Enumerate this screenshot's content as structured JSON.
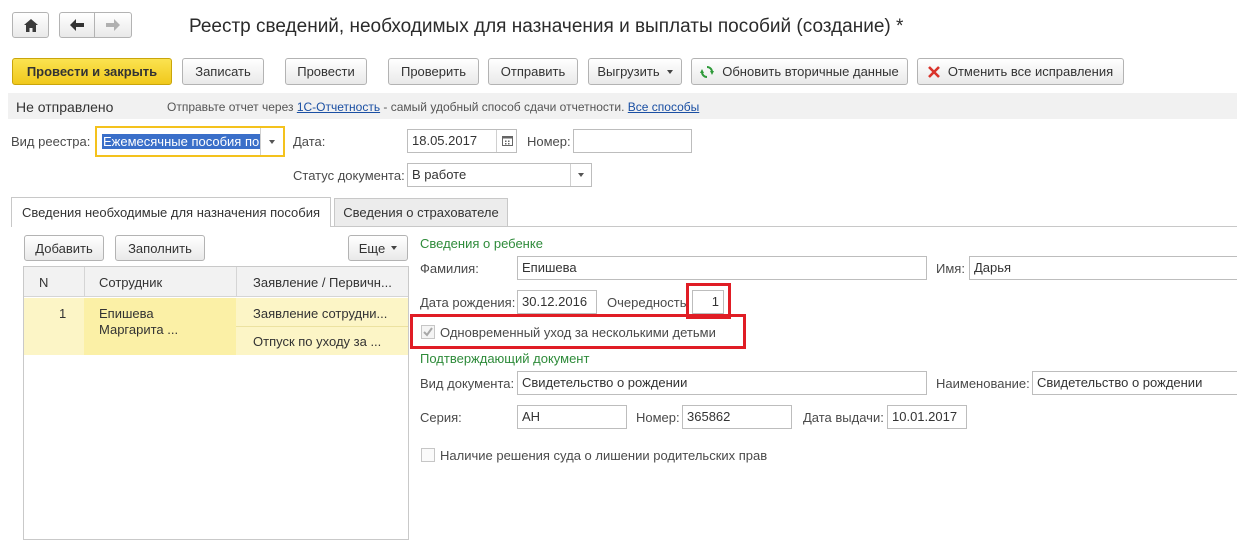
{
  "window": {
    "title": "Реестр сведений, необходимых для назначения и выплаты пособий (создание) *",
    "home_icon": "home-icon",
    "back_icon": "arrow-left-icon",
    "forward_icon": "arrow-right-icon"
  },
  "toolbar": {
    "post_close": "Провести и закрыть",
    "save": "Записать",
    "post": "Провести",
    "check": "Проверить",
    "send": "Отправить",
    "export": "Выгрузить",
    "refresh": "Обновить вторичные данные",
    "cancel_fixes": "Отменить все исправления"
  },
  "status_bar": {
    "status": "Не отправлено",
    "hint_prefix": "Отправьте отчет через ",
    "hint_link": "1С-Отчетность",
    "hint_suffix": " - самый удобный способ сдачи отчетности.",
    "all_ways": "Все способы"
  },
  "header_form": {
    "registry_type_label": "Вид реестра:",
    "registry_type_value": "Ежемесячные пособия по",
    "date_label": "Дата:",
    "date_value": "18.05.2017",
    "number_label": "Номер:",
    "number_value": "",
    "doc_status_label": "Статус документа:",
    "doc_status_value": "В работе"
  },
  "tabs": [
    {
      "label": "Сведения необходимые для назначения пособия",
      "active": true
    },
    {
      "label": "Сведения о страхователе",
      "active": false
    }
  ],
  "left_panel": {
    "add": "Добавить",
    "fill": "Заполнить",
    "more": "Еще",
    "columns": [
      "N",
      "Сотрудник",
      "Заявление / Первичн..."
    ],
    "rows": [
      {
        "n": "1",
        "employee_line1": "Епишева",
        "employee_line2": "Маргарита ...",
        "doc1": "Заявление сотрудни...",
        "doc2": "Отпуск по уходу за ..."
      }
    ]
  },
  "child_info": {
    "section_title": "Сведения о ребенке",
    "surname_label": "Фамилия:",
    "surname_value": "Епишева",
    "name_label": "Имя:",
    "name_value": "Дарья",
    "birth_label": "Дата рождения:",
    "birth_value": "30.12.2016",
    "order_label": "Очередность",
    "order_value": "1",
    "simultaneous_label": "Одновременный уход за несколькими детьми",
    "simultaneous_checked": true
  },
  "confirm_doc": {
    "section_title": "Подтверждающий документ",
    "doc_type_label": "Вид документа:",
    "doc_type_value": "Свидетельство о рождении",
    "doc_name_label": "Наименование:",
    "doc_name_value": "Свидетельство о рождении",
    "series_label": "Серия:",
    "series_value": "АН",
    "number_label": "Номер:",
    "number_value": "365862",
    "issue_label": "Дата выдачи:",
    "issue_value": "10.01.2017",
    "court_label": "Наличие решения суда о лишении родительских прав",
    "court_checked": false
  },
  "colors": {
    "accent_yellow": "#f5d32c",
    "row_highlight": "#fbf0a6",
    "row_sub": "#fcf5c6",
    "section_green": "#2e8b3a",
    "highlight_red": "#e01d25",
    "link_blue": "#1a4fa3"
  }
}
